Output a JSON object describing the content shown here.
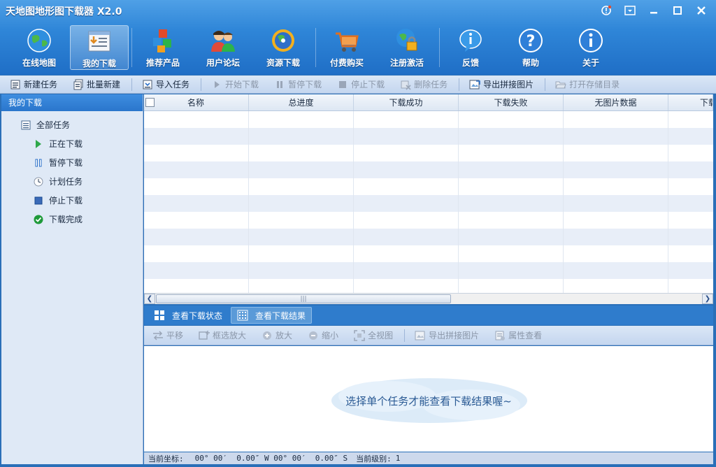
{
  "window": {
    "title": "天地图地形图下载器 X2.0",
    "controls": [
      "help-icon",
      "menu-icon",
      "minimize-icon",
      "maximize-icon",
      "close-icon"
    ]
  },
  "main_toolbar": [
    {
      "id": "online-map",
      "label": "在线地图",
      "icon": "globe-icon",
      "active": false
    },
    {
      "id": "my-downloads",
      "label": "我的下载",
      "icon": "download-list-icon",
      "active": true
    },
    {
      "id": "recommended",
      "label": "推荐产品",
      "icon": "cubes-icon",
      "active": false
    },
    {
      "id": "forum",
      "label": "用户论坛",
      "icon": "users-icon",
      "active": false
    },
    {
      "id": "resources",
      "label": "资源下载",
      "icon": "resource-disc-icon",
      "active": false
    },
    {
      "id": "purchase",
      "label": "付费购买",
      "icon": "cart-icon",
      "active": false
    },
    {
      "id": "register",
      "label": "注册激活",
      "icon": "lock-globe-icon",
      "active": false
    },
    {
      "id": "feedback",
      "label": "反馈",
      "icon": "info-bubble-icon",
      "active": false
    },
    {
      "id": "help",
      "label": "帮助",
      "icon": "question-icon",
      "active": false
    },
    {
      "id": "about",
      "label": "关于",
      "icon": "info-icon",
      "active": false
    }
  ],
  "task_toolbar": [
    {
      "label": "新建任务",
      "icon": "new-task-icon",
      "enabled": true
    },
    {
      "label": "批量新建",
      "icon": "batch-new-icon",
      "enabled": true
    },
    {
      "label": "导入任务",
      "icon": "import-task-icon",
      "enabled": true
    },
    {
      "label": "开始下载",
      "icon": "play-icon",
      "enabled": false
    },
    {
      "label": "暂停下载",
      "icon": "pause-icon",
      "enabled": false
    },
    {
      "label": "停止下载",
      "icon": "stop-icon",
      "enabled": false
    },
    {
      "label": "删除任务",
      "icon": "delete-icon",
      "enabled": false
    },
    {
      "label": "导出拼接图片",
      "icon": "export-image-icon",
      "enabled": true
    },
    {
      "label": "打开存储目录",
      "icon": "open-folder-icon",
      "enabled": false
    }
  ],
  "sidebar": {
    "header": "我的下载",
    "root": "全部任务",
    "items": [
      {
        "label": "正在下载",
        "icon": "play-green-icon"
      },
      {
        "label": "暂停下载",
        "icon": "pause-blue-icon"
      },
      {
        "label": "计划任务",
        "icon": "clock-icon"
      },
      {
        "label": "停止下载",
        "icon": "stop-square-icon"
      },
      {
        "label": "下载完成",
        "icon": "check-circle-icon"
      }
    ]
  },
  "table": {
    "columns": [
      "名称",
      "总进度",
      "下载成功",
      "下载失败",
      "无图片数据",
      "下载"
    ]
  },
  "bottom_tabs": [
    {
      "label": "查看下载状态",
      "icon": "grid-icon",
      "active": false
    },
    {
      "label": "查看下载结果",
      "icon": "dots-grid-icon",
      "active": true
    }
  ],
  "map_toolbar": [
    {
      "label": "平移",
      "icon": "pan-icon"
    },
    {
      "label": "框选放大",
      "icon": "box-zoom-icon"
    },
    {
      "label": "放大",
      "icon": "zoom-in-icon"
    },
    {
      "label": "缩小",
      "icon": "zoom-out-icon"
    },
    {
      "label": "全视图",
      "icon": "full-view-icon"
    },
    {
      "label": "导出拼接图片",
      "icon": "export-image-icon"
    },
    {
      "label": "属性查看",
      "icon": "properties-icon"
    }
  ],
  "view_message": "选择单个任务才能查看下载结果喔~",
  "status": {
    "coord_label": "当前坐标:",
    "coord_value": "00° 00′  0.00″ W 00° 00′  0.00″ S",
    "level_label": "当前级别:",
    "level_value": "1"
  }
}
